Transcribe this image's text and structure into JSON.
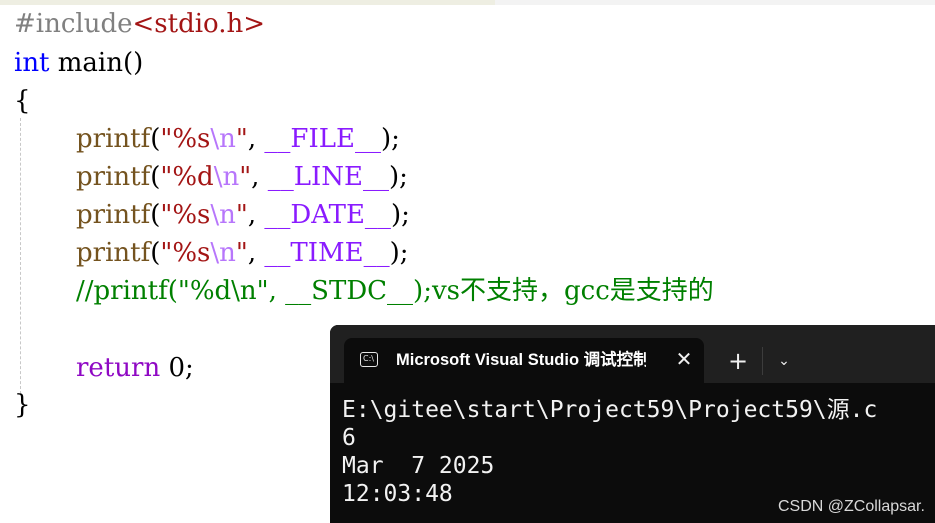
{
  "editor": {
    "lines": [
      {
        "pre": "#include",
        "header": "<stdio.h>"
      },
      {
        "type": "int",
        "name": " main()"
      },
      {
        "brace_open": "{"
      },
      {
        "fn": "printf",
        "open": "(",
        "q1": "\"%s",
        "esc": "\\n",
        "q2": "\"",
        "comma": ", ",
        "macro": "__FILE__",
        "close": ");"
      },
      {
        "fn": "printf",
        "open": "(",
        "q1": "\"%d",
        "esc": "\\n",
        "q2": "\"",
        "comma": ", ",
        "macro": "__LINE__",
        "close": ");"
      },
      {
        "fn": "printf",
        "open": "(",
        "q1": "\"%s",
        "esc": "\\n",
        "q2": "\"",
        "comma": ", ",
        "macro": "__DATE__",
        "close": ");"
      },
      {
        "fn": "printf",
        "open": "(",
        "q1": "\"%s",
        "esc": "\\n",
        "q2": "\"",
        "comma": ", ",
        "macro": "__TIME__",
        "close": ");"
      },
      {
        "comment": "//printf(\"%d\\n\", __STDC__);vs不支持，gcc是支持的"
      },
      {
        "keyword": "return",
        "rest": " 0;"
      },
      {
        "brace_close": "}"
      }
    ]
  },
  "terminal": {
    "tab_title": "Microsoft Visual Studio 调试控制台",
    "close_symbol": "✕",
    "new_tab_symbol": "+",
    "dropdown_symbol": "⌄",
    "icon_text": "C:\\",
    "output": [
      "E:\\gitee\\start\\Project59\\Project59\\源.c",
      "6",
      "Mar  7 2025",
      "12:03:48"
    ]
  },
  "watermark": "CSDN @ZCollapsar."
}
